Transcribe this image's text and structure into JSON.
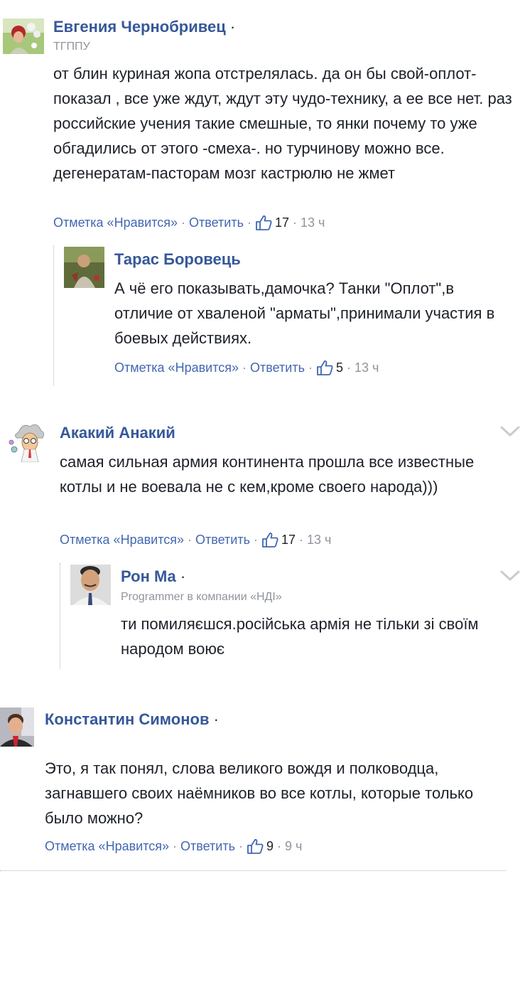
{
  "comments": [
    {
      "author": "Евгения Чернобривец",
      "dot": "·",
      "subtitle": "ТГППУ",
      "text": "от блин куриная жопа отстрелялась. да он бы свой-оплот- показал , все уже ждут, ждут эту чудо-технику, а ее все нет. раз российские учения такие смешные, то янки почему то уже обгадились от этого -смеха-. но турчинову можно все. дегенератам-пасторам мозг кастрюлю не жмет",
      "like_label": "Отметка «Нравится»",
      "reply_label": "Ответить",
      "likes": "17",
      "time": "13 ч",
      "replies": [
        {
          "author": "Тарас Боровець",
          "text": "А чё его показывать,дамочка? Танки \"Оплот\",в отличие от хваленой \"арматы\",принимали участия в боевых действиях.",
          "like_label": "Отметка «Нравится»",
          "reply_label": "Ответить",
          "likes": "5",
          "time": "13 ч"
        }
      ]
    },
    {
      "author": "Акакий Анакий",
      "text": "самая сильная армия континента прошла все известные котлы и не воевала не с кем,кроме своего народа)))",
      "like_label": "Отметка «Нравится»",
      "reply_label": "Ответить",
      "likes": "17",
      "time": "13 ч",
      "replies": [
        {
          "author": "Рон Ма",
          "dot": "·",
          "subtitle": "Programmer в компании «НДІ»",
          "text": "ти помиляєшся.російська армія не тільки зі своїм народом воює"
        }
      ]
    },
    {
      "author": "Константин Симонов",
      "dot": "·",
      "text": "Это, я так понял, слова великого вождя и полководца, загнавшего своих наёмников во все котлы, которые только было можно?",
      "like_label": "Отметка «Нравится»",
      "reply_label": "Ответить",
      "likes": "9",
      "time": "9 ч"
    }
  ],
  "separator": "·",
  "icons": {
    "like": "thumbs-up-icon",
    "menu": "chevron-down-icon"
  },
  "colors": {
    "link": "#4267b2",
    "author": "#365899",
    "meta": "#90949c",
    "text": "#1d2129"
  }
}
